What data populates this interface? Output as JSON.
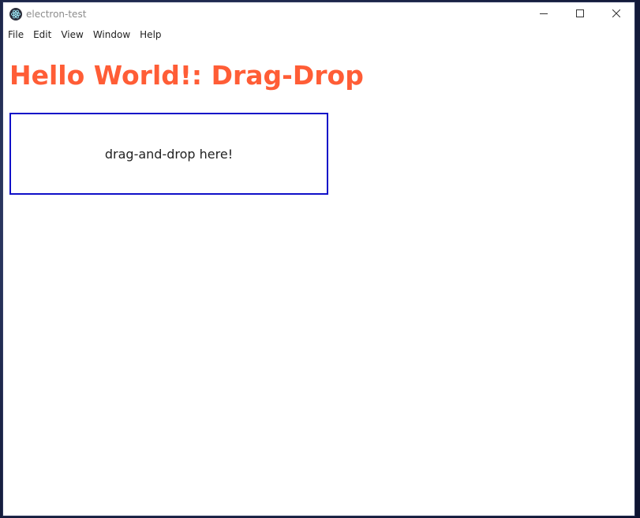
{
  "window": {
    "title": "electron-test"
  },
  "icons": {
    "app": "electron-icon",
    "minimize": "minimize-icon",
    "maximize": "maximize-icon",
    "close": "close-icon"
  },
  "menu": {
    "items": [
      {
        "label": "File"
      },
      {
        "label": "Edit"
      },
      {
        "label": "View"
      },
      {
        "label": "Window"
      },
      {
        "label": "Help"
      }
    ]
  },
  "main": {
    "heading": "Hello World!: Drag-Drop",
    "dropzone_text": "drag-and-drop here!"
  },
  "colors": {
    "heading": "#ff5d36",
    "dropzone_border": "#1010c8"
  }
}
